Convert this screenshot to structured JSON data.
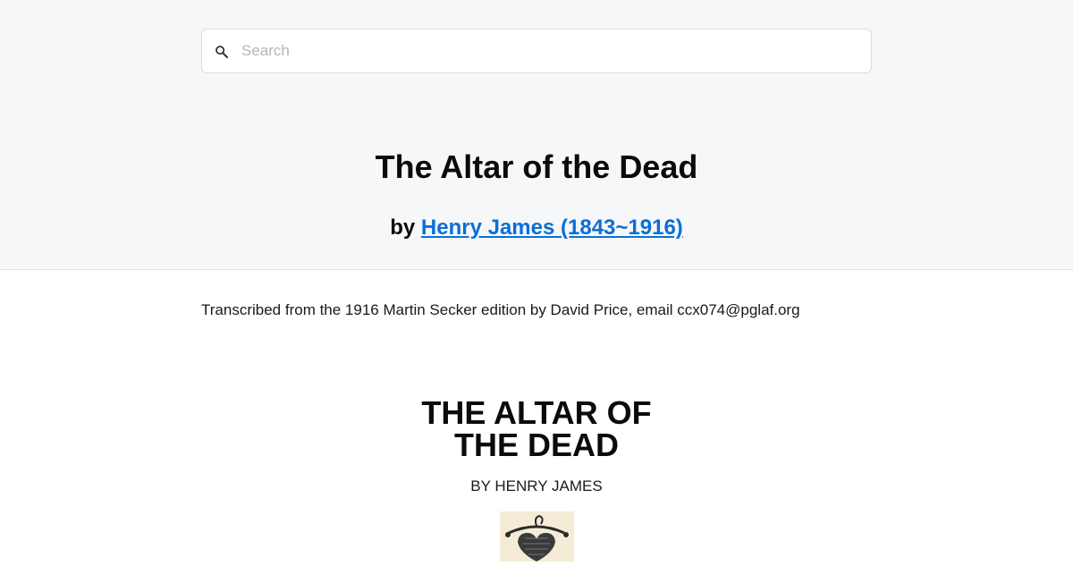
{
  "search": {
    "placeholder": "Search"
  },
  "header": {
    "title": "The Altar of the Dead",
    "by_label": "by",
    "author_link": "Henry James (1843~1916)"
  },
  "content": {
    "transcription_note": "Transcribed from the 1916 Martin Secker edition by David Price, email ccx074@pglaf.org",
    "book_title_line1": "THE ALTAR OF",
    "book_title_line2": "THE DEAD",
    "book_author": "BY HENRY JAMES",
    "ornament_icon": "decorative-ornament-icon"
  },
  "colors": {
    "header_bg": "#f6f7f9",
    "link": "#0a6fd6"
  }
}
